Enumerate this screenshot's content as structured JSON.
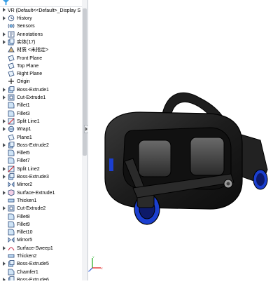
{
  "tree": {
    "root_label": "VR  (Default<<Default>_Display S",
    "items": [
      {
        "label": "History",
        "icon": "history-icon",
        "expand": true
      },
      {
        "label": "Sensors",
        "icon": "sensors-icon",
        "expand": false
      },
      {
        "label": "Annotations",
        "icon": "annotations-icon",
        "expand": true
      },
      {
        "label": "实体(17)",
        "icon": "solid-bodies-icon",
        "expand": true
      },
      {
        "label": "材质 <未指定>",
        "icon": "material-icon",
        "expand": false
      },
      {
        "label": "Front Plane",
        "icon": "plane-icon",
        "expand": false
      },
      {
        "label": "Top Plane",
        "icon": "plane-icon",
        "expand": false
      },
      {
        "label": "Right Plane",
        "icon": "plane-icon",
        "expand": false
      },
      {
        "label": "Origin",
        "icon": "origin-icon",
        "expand": false
      },
      {
        "label": "Boss-Extrude1",
        "icon": "boss-extrude-icon",
        "expand": true
      },
      {
        "label": "Cut-Extrude1",
        "icon": "cut-extrude-icon",
        "expand": true
      },
      {
        "label": "Fillet1",
        "icon": "fillet-icon",
        "expand": false
      },
      {
        "label": "Fillet3",
        "icon": "fillet-icon",
        "expand": false
      },
      {
        "label": "Split Line1",
        "icon": "split-line-icon",
        "expand": true
      },
      {
        "label": "Wrap1",
        "icon": "wrap-icon",
        "expand": true
      },
      {
        "label": "Plane1",
        "icon": "plane-icon",
        "expand": false
      },
      {
        "label": "Boss-Extrude2",
        "icon": "boss-extrude-icon",
        "expand": true
      },
      {
        "label": "Fillet5",
        "icon": "fillet-icon",
        "expand": false
      },
      {
        "label": "Fillet7",
        "icon": "fillet-icon",
        "expand": false
      },
      {
        "label": "Split Line2",
        "icon": "split-line-icon",
        "expand": true
      },
      {
        "label": "Boss-Extrude3",
        "icon": "boss-extrude-icon",
        "expand": true
      },
      {
        "label": "Mirror2",
        "icon": "mirror-icon",
        "expand": false
      },
      {
        "label": "Surface-Extrude1",
        "icon": "surface-extrude-icon",
        "expand": true
      },
      {
        "label": "Thicken1",
        "icon": "thicken-icon",
        "expand": false
      },
      {
        "label": "Cut-Extrude2",
        "icon": "cut-extrude-icon",
        "expand": true
      },
      {
        "label": "Fillet8",
        "icon": "fillet-icon",
        "expand": false
      },
      {
        "label": "Fillet9",
        "icon": "fillet-icon",
        "expand": false
      },
      {
        "label": "Fillet10",
        "icon": "fillet-icon",
        "expand": false
      },
      {
        "label": "Mirror5",
        "icon": "mirror-icon",
        "expand": false
      },
      {
        "label": "Surface-Sweep1",
        "icon": "surface-sweep-icon",
        "expand": true
      },
      {
        "label": "Thicken2",
        "icon": "thicken-icon",
        "expand": false
      },
      {
        "label": "Boss-Extrude5",
        "icon": "boss-extrude-icon",
        "expand": true
      },
      {
        "label": "Chamfer1",
        "icon": "chamfer-icon",
        "expand": false
      },
      {
        "label": "Boss-Extrude6",
        "icon": "boss-extrude-icon",
        "expand": true
      }
    ]
  },
  "viewport": {
    "model": "vr-headset-model",
    "axis_labels": {
      "x": "X",
      "y": "Y",
      "z": "Z"
    }
  },
  "colors": {
    "accent": "#3aa0e6",
    "headset_body": "#1c1c1c",
    "lens_blue": "#1b3fd0"
  }
}
